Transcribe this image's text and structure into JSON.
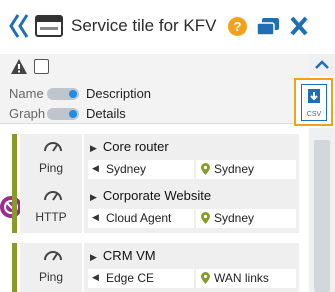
{
  "header": {
    "title": "Service tile for KFV",
    "help_label": "?"
  },
  "toolbar": {
    "scroll_up_icon": "chevron-up-icon"
  },
  "filters": [
    {
      "label": "Name",
      "value": "Description"
    },
    {
      "label": "Graph",
      "value": "Details"
    }
  ],
  "csv": {
    "label": "CSV"
  },
  "tiles": [
    {
      "check_type": "Ping",
      "name": "Core router",
      "field1": "Sydney",
      "field2": "Sydney",
      "alert": false
    },
    {
      "check_type": "HTTP",
      "name": "Corporate Website",
      "field1": "Cloud Agent",
      "field2": "Sydney",
      "alert": true
    },
    {
      "check_type": "Ping",
      "name": "CRM VM",
      "field1": "Edge CE",
      "field2": "WAN links",
      "alert": false
    }
  ],
  "colors": {
    "accent": "#1f6fb5",
    "help": "#f0a21a",
    "status_ok": "#8a9a2a",
    "alert": "#9b2d8e"
  }
}
